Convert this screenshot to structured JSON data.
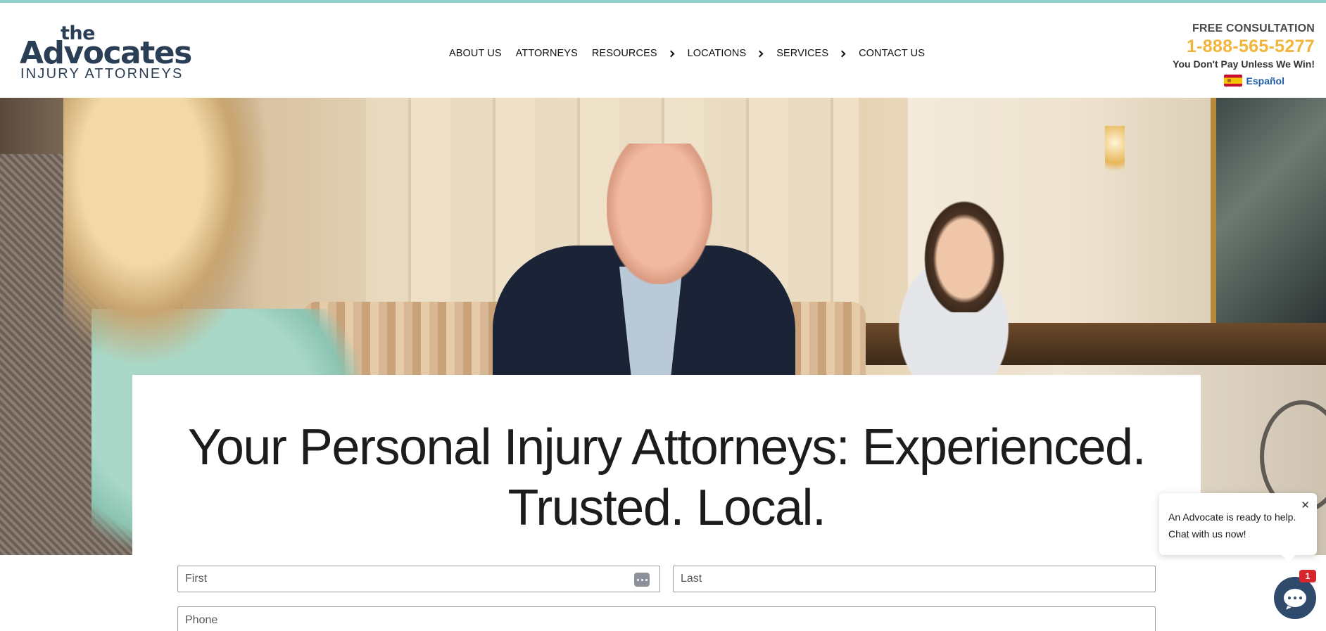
{
  "brand": {
    "logo_the": "the",
    "logo_main": "Advocates",
    "logo_sub": "INJURY ATTORNEYS",
    "primary_color": "#2a3e55",
    "accent_color": "#f2b53b"
  },
  "nav": {
    "items": [
      {
        "label": "ABOUT US",
        "has_submenu": false
      },
      {
        "label": "ATTORNEYS",
        "has_submenu": false
      },
      {
        "label": "RESOURCES",
        "has_submenu": true
      },
      {
        "label": "LOCATIONS",
        "has_submenu": true
      },
      {
        "label": "SERVICES",
        "has_submenu": true
      },
      {
        "label": "CONTACT US",
        "has_submenu": false
      }
    ]
  },
  "cta": {
    "free_consultation": "FREE CONSULTATION",
    "phone": "1-888-565-5277",
    "tagline": "You Don't Pay Unless We Win!",
    "language_link": "Español"
  },
  "hero": {
    "headline_line1": "Your Personal Injury Attorneys: Experienced.",
    "headline_line2": "Trusted. Local."
  },
  "form": {
    "first_placeholder": "First",
    "last_placeholder": "Last",
    "phone_placeholder": "Phone"
  },
  "chat": {
    "line1": "An Advocate is ready to help.",
    "line2": "Chat with us now!",
    "close_glyph": "✕",
    "badge_count": "1"
  }
}
